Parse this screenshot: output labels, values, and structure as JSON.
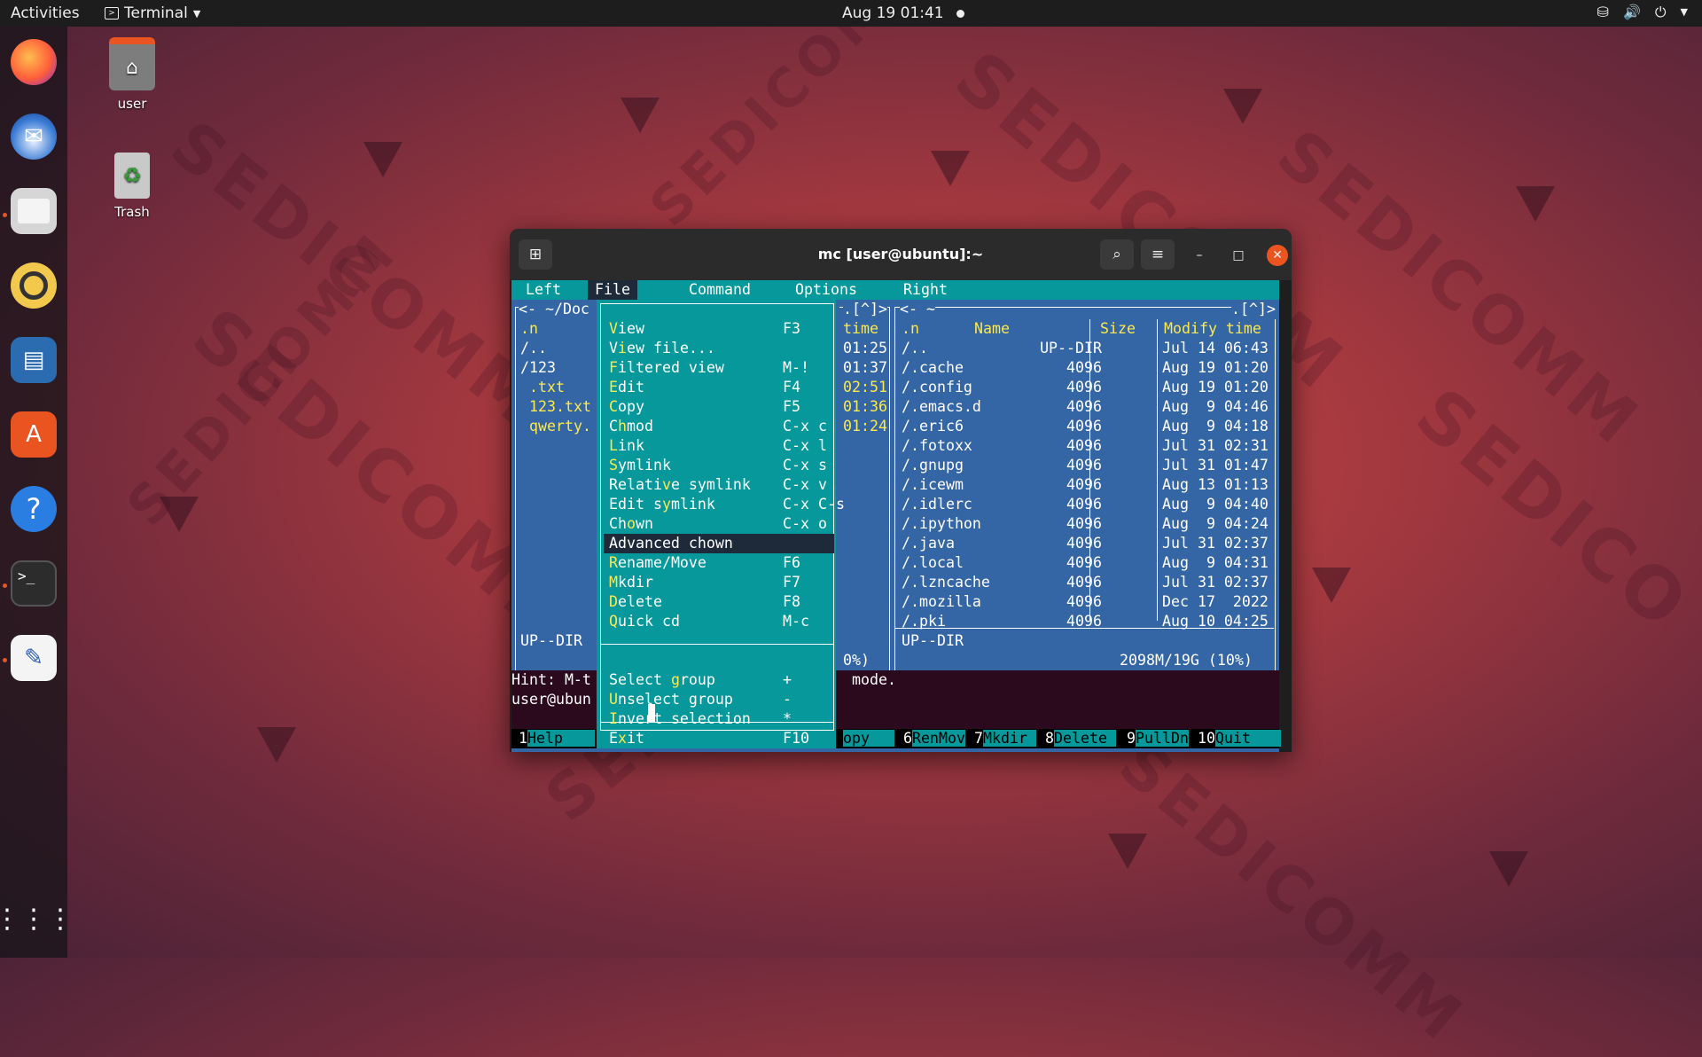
{
  "topbar": {
    "activities": "Activities",
    "app_name": "Terminal",
    "clock": "Aug 19  01:41"
  },
  "desktop": {
    "home_label": "user",
    "trash_label": "Trash"
  },
  "window": {
    "title": "mc [user@ubuntu]:~"
  },
  "mc": {
    "menubar": [
      "Left",
      "File",
      "Command",
      "Options",
      "Right"
    ],
    "left_panel": {
      "path": "<- ~/Doc",
      "header_n": ".n",
      "rows": [
        "/..",
        "/123",
        ".txt",
        "123.txt",
        "qwerty."
      ],
      "times_header": "time",
      "times": [
        "01:25",
        "01:37",
        "02:51",
        "01:36",
        "01:24"
      ],
      "top_right": ".[^]>",
      "status": "UP--DIR",
      "percent": "0%)"
    },
    "file_menu": [
      {
        "label": "View",
        "hot": "V",
        "key": "F3"
      },
      {
        "label": "View file...",
        "hot": "i",
        "key": ""
      },
      {
        "label": "Filtered view",
        "hot": "F",
        "key": "M-!"
      },
      {
        "label": "Edit",
        "hot": "E",
        "key": "F4"
      },
      {
        "label": "Copy",
        "hot": "C",
        "key": "F5"
      },
      {
        "label": "Chmod",
        "hot": "h",
        "key": "C-x c"
      },
      {
        "label": "Link",
        "hot": "L",
        "key": "C-x l"
      },
      {
        "label": "Symlink",
        "hot": "S",
        "key": "C-x s"
      },
      {
        "label": "Relative symlink",
        "hot": "v",
        "key": "C-x v"
      },
      {
        "label": "Edit symlink",
        "hot": "y",
        "key": "C-x C-s"
      },
      {
        "label": "Chown",
        "hot": "o",
        "key": "C-x o"
      },
      {
        "label": "Advanced chown",
        "hot": "A",
        "key": ""
      },
      {
        "label": "Rename/Move",
        "hot": "R",
        "key": "F6"
      },
      {
        "label": "Mkdir",
        "hot": "M",
        "key": "F7"
      },
      {
        "label": "Delete",
        "hot": "D",
        "key": "F8"
      },
      {
        "label": "Quick cd",
        "hot": "Q",
        "key": "M-c"
      }
    ],
    "file_menu2": [
      {
        "label": "Select group",
        "hot": "g",
        "key": "+"
      },
      {
        "label": "Unselect group",
        "hot": "U",
        "key": "-"
      },
      {
        "label": "Invert selection",
        "hot": "I",
        "key": "*"
      }
    ],
    "exit_item": {
      "label": "Exit",
      "hot": "x",
      "key": "F10"
    },
    "right_panel": {
      "path": "<- ~",
      "top_right": ".[^]>",
      "col_n": ".n",
      "col_name": "Name",
      "col_size": "Size",
      "col_modify": "Modify time",
      "rows": [
        {
          "name": "/..",
          "size": "UP--DIR",
          "time": "Jul 14 06:43"
        },
        {
          "name": "/.cache",
          "size": "4096",
          "time": "Aug 19 01:20"
        },
        {
          "name": "/.config",
          "size": "4096",
          "time": "Aug 19 01:20"
        },
        {
          "name": "/.emacs.d",
          "size": "4096",
          "time": "Aug  9 04:46"
        },
        {
          "name": "/.eric6",
          "size": "4096",
          "time": "Aug  9 04:18"
        },
        {
          "name": "/.fotoxx",
          "size": "4096",
          "time": "Jul 31 02:31"
        },
        {
          "name": "/.gnupg",
          "size": "4096",
          "time": "Jul 31 01:47"
        },
        {
          "name": "/.icewm",
          "size": "4096",
          "time": "Aug 13 01:13"
        },
        {
          "name": "/.idlerc",
          "size": "4096",
          "time": "Aug  9 04:40"
        },
        {
          "name": "/.ipython",
          "size": "4096",
          "time": "Aug  9 04:24"
        },
        {
          "name": "/.java",
          "size": "4096",
          "time": "Jul 31 02:37"
        },
        {
          "name": "/.local",
          "size": "4096",
          "time": "Aug  9 04:31"
        },
        {
          "name": "/.lzncache",
          "size": "4096",
          "time": "Jul 31 02:37"
        },
        {
          "name": "/.mozilla",
          "size": "4096",
          "time": "Dec 17  2022"
        },
        {
          "name": "/.pki",
          "size": "4096",
          "time": "Aug 10 04:25"
        }
      ],
      "status": "UP--DIR",
      "disk": "2098M/19G (10%)"
    },
    "hint_left": "Hint: M-t",
    "hint_right": "mode.",
    "prompt": "user@ubun",
    "fkeys": [
      {
        "n": "1",
        "l": "Help"
      },
      {
        "n": "",
        "l": "opy"
      },
      {
        "n": "6",
        "l": "RenMov"
      },
      {
        "n": "7",
        "l": "Mkdir"
      },
      {
        "n": "8",
        "l": "Delete"
      },
      {
        "n": "9",
        "l": "PullDn"
      },
      {
        "n": "10",
        "l": "Quit"
      }
    ]
  }
}
